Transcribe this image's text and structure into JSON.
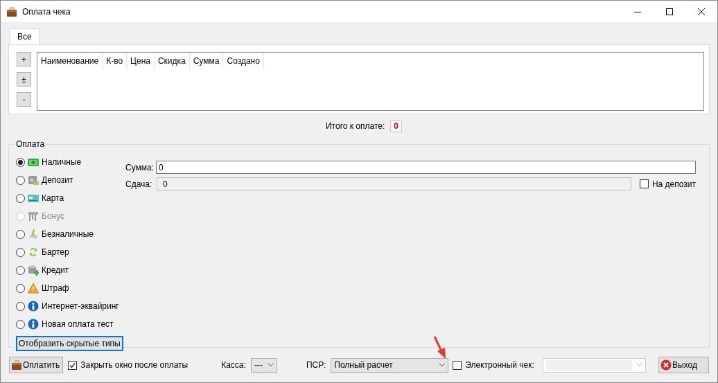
{
  "window": {
    "title": "Оплата чека"
  },
  "tabs": [
    {
      "label": "Все",
      "selected": true
    }
  ],
  "item_buttons": [
    "+",
    "±",
    "-"
  ],
  "table": {
    "columns": [
      "Наименование",
      "К-во",
      "Цена",
      "Скидка",
      "Сумма",
      "Создано"
    ]
  },
  "total": {
    "label": "Итого к оплате:",
    "value": "0"
  },
  "payment": {
    "title": "Оплата",
    "methods": [
      {
        "label": "Наличные",
        "kind": "cash",
        "selected": true,
        "disabled": false
      },
      {
        "label": "Депозит",
        "kind": "safe",
        "selected": false,
        "disabled": false
      },
      {
        "label": "Карта",
        "kind": "card",
        "selected": false,
        "disabled": false
      },
      {
        "label": "Бонус",
        "kind": "bonus",
        "selected": false,
        "disabled": true
      },
      {
        "label": "Безналичные",
        "kind": "pen",
        "selected": false,
        "disabled": false
      },
      {
        "label": "Бартер",
        "kind": "exchange",
        "selected": false,
        "disabled": false
      },
      {
        "label": "Кредит",
        "kind": "credit",
        "selected": false,
        "disabled": false
      },
      {
        "label": "Штраф",
        "kind": "warning",
        "selected": false,
        "disabled": false
      },
      {
        "label": "Интернет-эквайринг",
        "kind": "info",
        "selected": false,
        "disabled": false
      },
      {
        "label": "Новая оплата тест",
        "kind": "info",
        "selected": false,
        "disabled": false
      }
    ],
    "show_hidden_button": "Отобразить скрытые типы",
    "sum": {
      "label": "Сумма:",
      "value": "0"
    },
    "change": {
      "label": "Сдача:",
      "value": "0"
    },
    "to_deposit": {
      "label": "На депозит",
      "checked": false
    }
  },
  "footer": {
    "pay_button": "Оплатить",
    "close_after": {
      "label": "Закрыть окно после оплаты",
      "checked": true
    },
    "register": {
      "label": "Касса:",
      "value": "---"
    },
    "psr": {
      "label": "ПСР:",
      "value": "Полный расчет"
    },
    "e_receipt": {
      "label": "Электронный чек:",
      "checked": false
    },
    "exit_button": "Выход"
  }
}
